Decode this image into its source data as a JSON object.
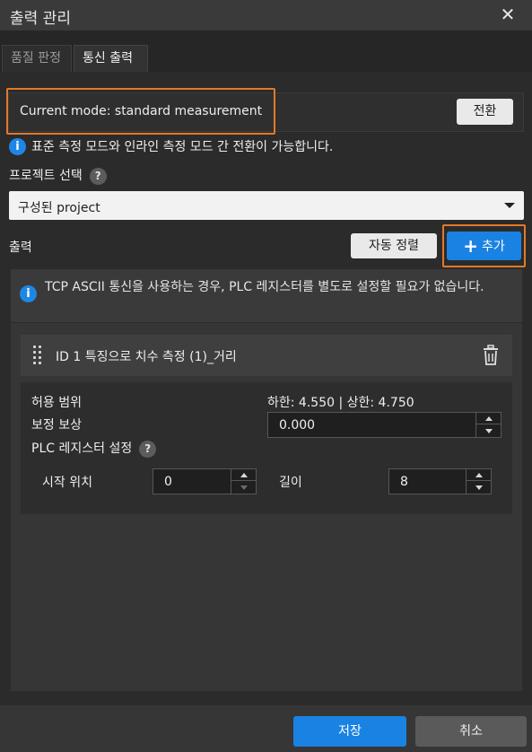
{
  "window": {
    "title": "출력 관리"
  },
  "tabs": [
    {
      "label": "품질 판정"
    },
    {
      "label": "통신 출력"
    }
  ],
  "mode": {
    "text": "Current mode: standard measurement",
    "switch_label": "전환"
  },
  "mode_info": "표준 측정 모드와 인라인 측정 모드 간 전환이 가능합니다.",
  "project": {
    "label": "프로젝트 선택",
    "selected": "구성된 project"
  },
  "output": {
    "label": "출력",
    "auto_sort_label": "자동 정렬",
    "add_label": "추가"
  },
  "notice": "TCP ASCII 통신을 사용하는 경우, PLC 레지스터를 별도로 설정할 필요가 없습니다.",
  "item": {
    "title": "ID 1  특징으로 치수 측정 (1)_거리",
    "tolerance_label": "허용 범위",
    "tolerance_value": "하한: 4.550 | 상한: 4.750",
    "compensation_label": "보정 보상",
    "compensation_value": "0.000",
    "plc_label": "PLC 레지스터 설정",
    "start_label": "시작 위치",
    "start_value": "0",
    "length_label": "길이",
    "length_value": "8"
  },
  "footer": {
    "save_label": "저장",
    "cancel_label": "취소"
  },
  "colors": {
    "accent": "#1a82e3",
    "highlight": "#e07a2a",
    "background": "#2b2b2b"
  },
  "icons": {
    "close": "close-icon",
    "info": "info-icon",
    "help": "help-icon",
    "caret": "chevron-down-icon",
    "drag": "drag-handle-icon",
    "trash": "trash-icon",
    "plus": "plus-icon"
  }
}
